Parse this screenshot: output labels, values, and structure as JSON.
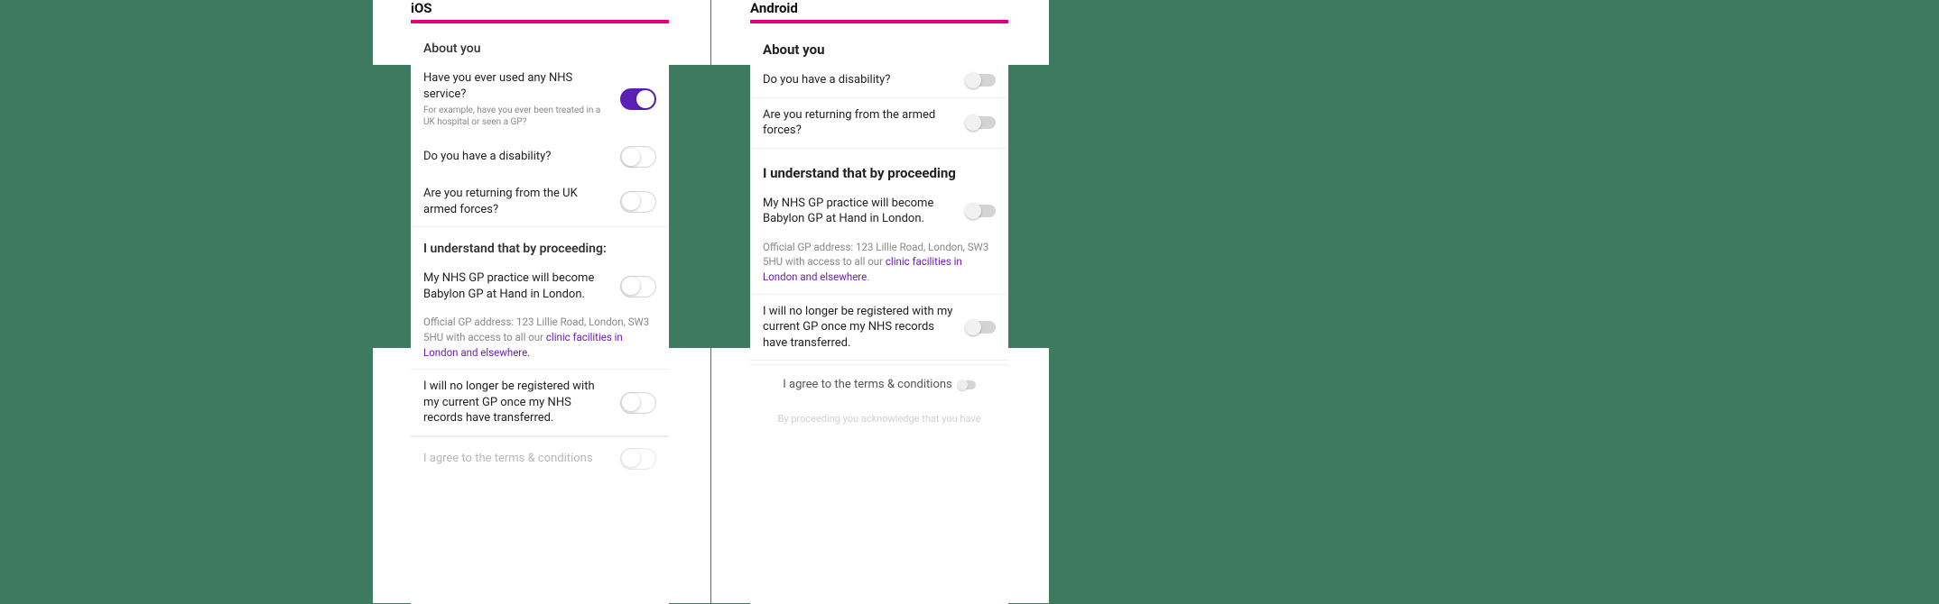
{
  "ios": {
    "platform_label": "iOS",
    "about_title": "About you",
    "q_nhs": "Have you ever used any NHS service?",
    "q_nhs_sub": "For example, have you ever been treated in a UK hospital or seen a GP?",
    "q_disability": "Do you have a disability?",
    "q_armed": "Are you returning from the UK armed forces?",
    "proceed_title": "I understand that by proceeding:",
    "c_gp": "My NHS GP practice will become Babylon GP at Hand in London.",
    "gp_note_pre": "Official GP address: 123 Lillie Road, London, SW3 5HU with access to all our ",
    "gp_note_link": "clinic facilities in London and elsewhere.",
    "c_dereg": "I will no longer be registered with my current GP once my NHS records have transferred.",
    "terms": "I agree to the terms & conditions"
  },
  "android": {
    "platform_label": "Android",
    "about_title": "About you",
    "q_disability": "Do you have a disability?",
    "q_armed": "Are you returning from the armed forces?",
    "proceed_title": "I understand that by proceeding",
    "c_gp": "My NHS GP practice will become Babylon GP at Hand in London.",
    "gp_note_pre": "Official GP address: 123 Lillie Road, London, SW3 5HU with access to all our ",
    "gp_note_link": "clinic facilities in London and elsewhere",
    "gp_note_post": ".",
    "c_dereg": "I will no longer be registered with my current GP once my NHS records have transferred.",
    "terms": "I agree to the terms & conditions",
    "tail": "By proceeding you acknowledge that you have"
  }
}
